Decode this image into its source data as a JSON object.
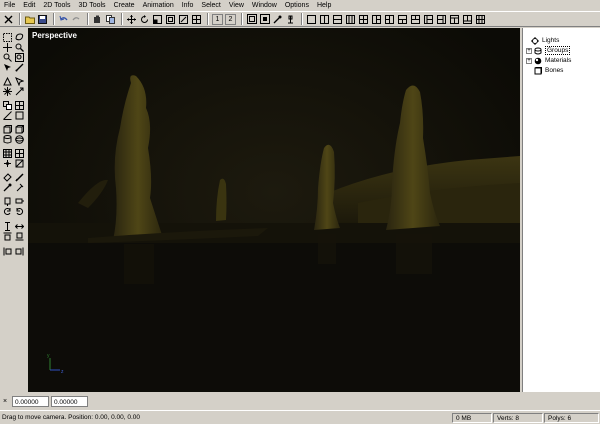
{
  "menu": [
    "File",
    "Edit",
    "2D Tools",
    "3D Tools",
    "Create",
    "Animation",
    "Info",
    "Select",
    "View",
    "Window",
    "Options",
    "Help"
  ],
  "toolbar": {
    "buttons_a": [
      "close-icon",
      "open-icon",
      "save-icon",
      "undo-icon",
      "redo-icon",
      "cut-icon",
      "copy-icon",
      "move-icon",
      "rotate-icon",
      "scale-icon",
      "frame-icon",
      "snap-icon",
      "grid-icon"
    ],
    "view_nums": [
      "1",
      "2"
    ],
    "buttons_b": [
      "select-all-icon",
      "select-icon",
      "picker-icon",
      "text-icon"
    ],
    "layouts": [
      "layout-1",
      "layout-2",
      "layout-3",
      "layout-4",
      "layout-5",
      "layout-6",
      "layout-7",
      "layout-8",
      "layout-9",
      "layout-10",
      "layout-11",
      "layout-12",
      "layout-13",
      "layout-14"
    ]
  },
  "viewport": {
    "label": "Perspective",
    "background": "#13110a",
    "accent": "#4a4312"
  },
  "scene_tree": {
    "items": [
      {
        "label": "Lights",
        "expandable": false,
        "icon": "light-icon"
      },
      {
        "label": "Groups",
        "expandable": true,
        "icon": "groups-icon"
      },
      {
        "label": "Materials",
        "expandable": true,
        "icon": "materials-icon"
      },
      {
        "label": "Bones",
        "expandable": false,
        "icon": "bones-icon"
      }
    ]
  },
  "coords": {
    "x": "0.00000",
    "y": "0.00000"
  },
  "status": {
    "message": "Drag to move camera. Position: 0.00, 0.00, 0.00",
    "memory": "0 MB",
    "verts": "Verts: 8",
    "polys": "Polys: 6"
  }
}
